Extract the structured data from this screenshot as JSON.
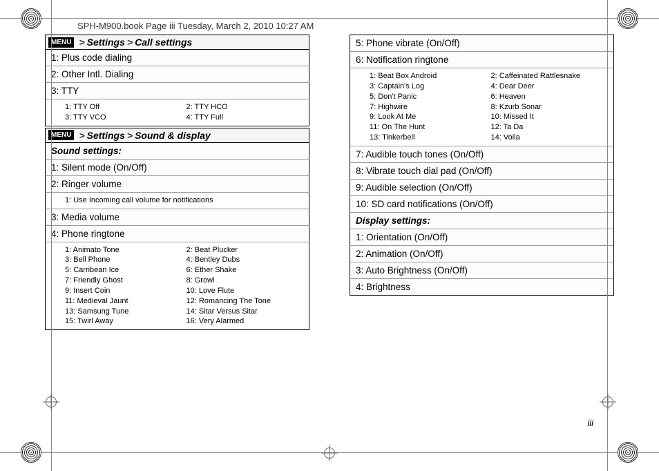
{
  "header": "SPH-M900.book  Page iii  Tuesday, March 2, 2010  10:27 AM",
  "page_number": "iii",
  "menu_label": "MENU",
  "bc_sep": ">",
  "call_settings": {
    "path": [
      "Settings",
      "Call settings"
    ],
    "items": [
      "1: Plus code dialing",
      "2: Other Intl. Dialing",
      "3: TTY"
    ],
    "tty_sub": [
      "1: TTY Off",
      "2: TTY HCO",
      "3: TTY VCO",
      "4: TTY Full"
    ]
  },
  "sound_display": {
    "path": [
      "Settings",
      "Sound & display"
    ],
    "sound_header": "Sound settings:",
    "sound_items": [
      "1: Silent mode (On/Off)",
      "2: Ringer volume"
    ],
    "ringer_sub": [
      "1: Use Incoming call volume for notifications"
    ],
    "sound_items2": [
      "3: Media volume",
      "4: Phone ringtone"
    ],
    "ringtone_sub": [
      "1: Animato Tone",
      "2: Beat Plucker",
      "3: Bell Phone",
      "4: Bentley Dubs",
      "5: Carribean Ice",
      "6: Ether Shake",
      "7: Friendly Ghost",
      "8: Growl",
      "9: Insert Coin",
      "10: Love Flute",
      "11: Medieval Jaunt",
      "12: Romancing The Tone",
      "13: Samsung Tune",
      "14: Sitar Versus Sitar",
      "15: Twirl Away",
      "16: Very Alarmed"
    ],
    "sound_items3": [
      "5: Phone vibrate (On/Off)",
      "6: Notification ringtone"
    ],
    "notification_sub": [
      "1: Beat Box Android",
      "2: Caffeinated Rattlesnake",
      "3: Captain's Log",
      "4: Dear Deer",
      "5: Don't Panic",
      "6: Heaven",
      "7: Highwire",
      "8: Kzurb Sonar",
      "9: Look At Me",
      "10: Missed It",
      "11: On The Hunt",
      "12: Ta Da",
      "13: Tinkerbell",
      "14: Voila"
    ],
    "sound_items4": [
      "7: Audible touch tones (On/Off)",
      "8: Vibrate touch dial pad (On/Off)",
      "9: Audible selection (On/Off)",
      "10: SD card notifications (On/Off)"
    ],
    "display_header": "Display settings:",
    "display_items": [
      "1: Orientation (On/Off)",
      "2: Animation (On/Off)",
      "3: Auto Brightness (On/Off)",
      "4: Brightness"
    ]
  }
}
